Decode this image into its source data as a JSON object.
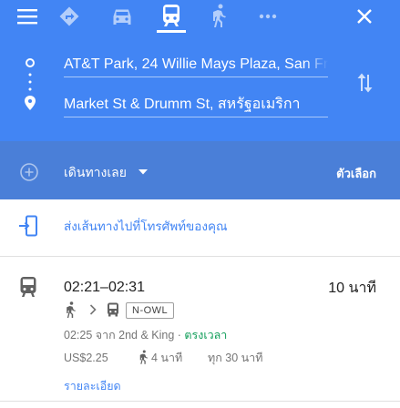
{
  "modes": {
    "icons": [
      "menu-icon",
      "directions-icon",
      "car-icon",
      "transit-icon",
      "walk-icon",
      "more-icon",
      "close-icon"
    ],
    "selected": "transit"
  },
  "route": {
    "origin": "AT&T Park, 24 Willie Mays Plaza, San Fr",
    "destination": "Market St & Drumm St, สหรัฐอเมริกา"
  },
  "options": {
    "depart_label": "เดินทางเลย",
    "options_label": "ตัวเลือก"
  },
  "send": {
    "label": "ส่งเส้นทางไปที่โทรศัพท์ของคุณ"
  },
  "trip": {
    "time_range": "02:21–02:31",
    "duration": "10 นาที",
    "line_badge": "N-OWL",
    "depart_text": "02:25 จาก 2nd & King · ",
    "status": "ตรงเวลา",
    "fare": "US$2.25",
    "walk_time": "4 นาที",
    "frequency": "ทุก 30 นาที",
    "details_link": "รายละเอียด"
  },
  "colors": {
    "header": "#4285f4",
    "options_bar": "#4a7fd8",
    "link": "#4285f4",
    "on_time": "#0f9d58"
  }
}
